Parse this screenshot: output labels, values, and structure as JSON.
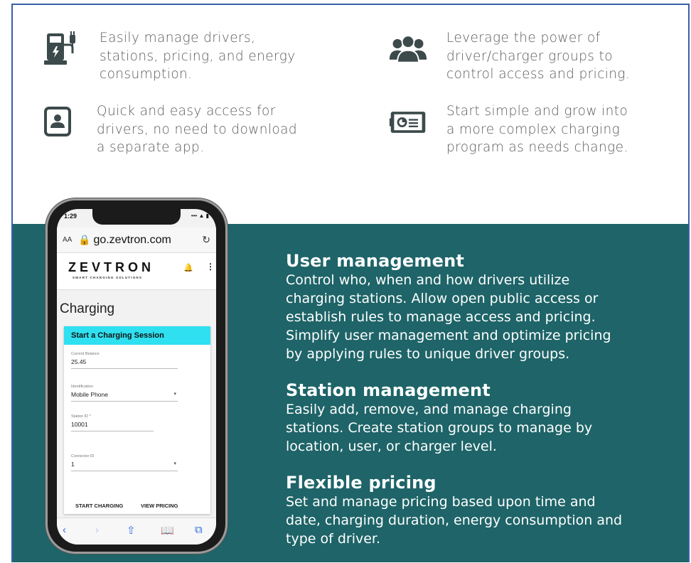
{
  "features": [
    {
      "icon": "ev-charger-icon",
      "text_lines": [
        "Easily manage drivers,",
        "stations, pricing, and energy",
        "consumption."
      ]
    },
    {
      "icon": "user-group-icon",
      "text_lines": [
        "Leverage the power of",
        "driver/charger groups to",
        "control access and pricing."
      ]
    },
    {
      "icon": "user-card-icon",
      "text_lines": [
        "Quick and easy access for",
        "drivers, no need to download",
        "a separate app."
      ]
    },
    {
      "icon": "dashboard-card-icon",
      "text_lines": [
        "Start simple and grow into",
        "a more complex charging",
        "program as needs change."
      ]
    }
  ],
  "sections": [
    {
      "title": "User management",
      "body_lines": [
        "Control who, when and how drivers utilize",
        "charging stations. Allow open public access or",
        "establish rules to manage access and pricing.",
        "Simplify user management and optimize pricing",
        "by applying rules to unique driver groups."
      ]
    },
    {
      "title": "Station management",
      "body_lines": [
        "Easily add, remove, and manage charging",
        "stations. Create station groups to manage by",
        "location, user, or charger level."
      ]
    },
    {
      "title": "Flexible pricing",
      "body_lines": [
        "Set and manage pricing based upon time and",
        "date, charging duration, energy consumption and",
        "type of driver."
      ]
    }
  ],
  "phone": {
    "time": "1:29",
    "status_icons": "••• ▲ ▮",
    "aa": "AA",
    "url": "go.zevtron.com",
    "logo": "ZEVTRON",
    "logo_sub": "SMART CHARGING SOLUTIONS",
    "page_title": "Charging",
    "card_title": "Start a Charging Session",
    "fields": [
      {
        "label": "Current Balance",
        "value": "25.45"
      },
      {
        "label": "Identification",
        "value": "Mobile Phone"
      },
      {
        "label": "Station ID *",
        "value": "10001"
      },
      {
        "label": "Connector ID",
        "value": "1"
      }
    ],
    "start_button": "START CHARGING",
    "pricing_button": "VIEW PRICING"
  }
}
